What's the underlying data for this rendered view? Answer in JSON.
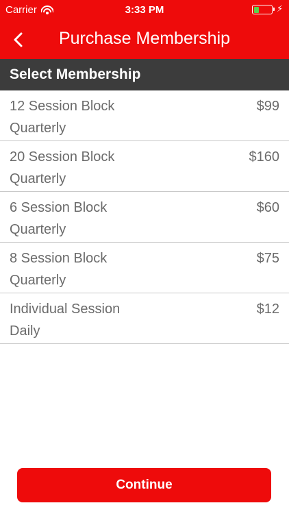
{
  "status_bar": {
    "carrier": "Carrier",
    "time": "3:33 PM",
    "battery_level": 0.25,
    "charging": true,
    "battery_color": "#58d34b"
  },
  "nav": {
    "title": "Purchase Membership",
    "back_icon": "chevron-left-icon"
  },
  "section": {
    "title": "Select Membership"
  },
  "memberships": [
    {
      "name": "12 Session Block",
      "period": "Quarterly",
      "price": "$99"
    },
    {
      "name": "20 Session Block",
      "period": "Quarterly",
      "price": "$160"
    },
    {
      "name": "6 Session Block",
      "period": "Quarterly",
      "price": "$60"
    },
    {
      "name": "8 Session Block",
      "period": "Quarterly",
      "price": "$75"
    },
    {
      "name": "Individual Session",
      "period": "Daily",
      "price": "$12"
    }
  ],
  "continue_label": "Continue",
  "colors": {
    "accent": "#ee0b0b",
    "header_bg": "#3c3c3c",
    "text_gray": "#6b6b6b"
  }
}
